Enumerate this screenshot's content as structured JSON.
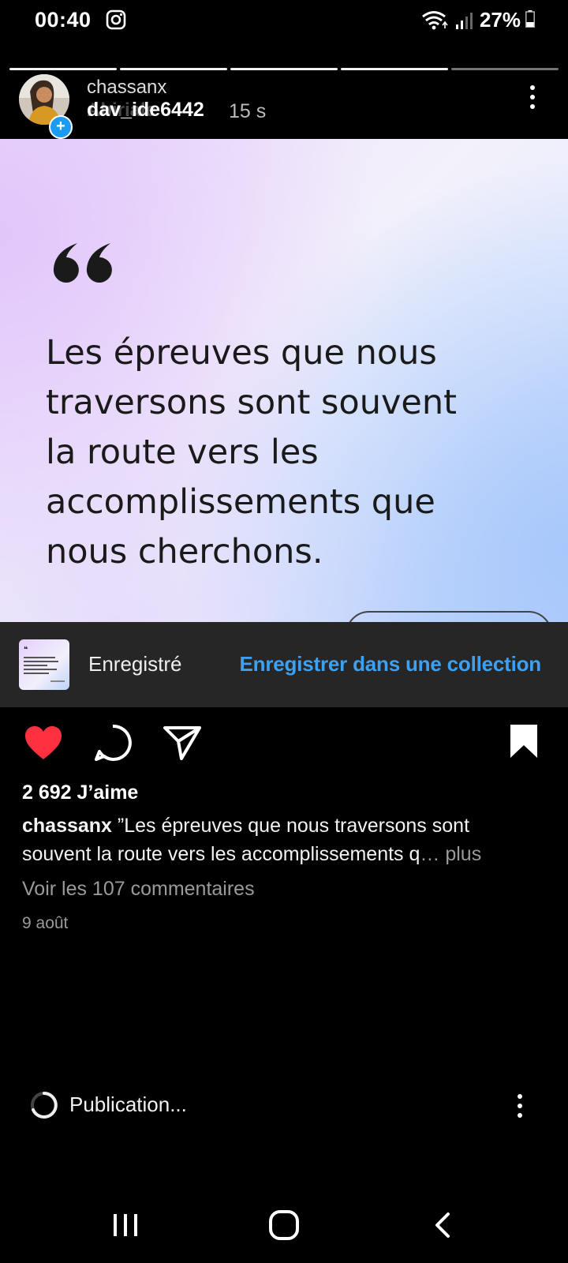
{
  "status_bar": {
    "time": "00:40",
    "battery": "27%",
    "icons": [
      "instagram-icon",
      "wifi-icon",
      "signal-icon",
      "battery-icon"
    ]
  },
  "story": {
    "segments_total": 5,
    "segments_done": 4,
    "username_primary": "chassanx",
    "username_secondary": "dav_ide6442",
    "username_overlap": "Abiriale",
    "time_ago": "15 s",
    "plus_badge": "+"
  },
  "post_image": {
    "quote_lines": [
      "Les épreuves que nous",
      "traversons sont souvent",
      "la route vers les",
      "accomplissements que",
      "nous cherchons."
    ]
  },
  "saved_banner": {
    "label": "Enregistré",
    "action": "Enregistrer dans une collection"
  },
  "actions": {
    "liked": true,
    "saved": true,
    "colors": {
      "like": "#ff3040",
      "link": "#3ea0f0"
    }
  },
  "post": {
    "likes": "2 692 J’aime",
    "caption_user": "chassanx",
    "caption_text": " ”Les épreuves que nous traversons sont souvent la route vers les accomplissements q",
    "caption_more": "… plus",
    "comments_link": "Voir les 107 commentaires",
    "date": "9 août"
  },
  "publishing": {
    "label": "Publication..."
  }
}
